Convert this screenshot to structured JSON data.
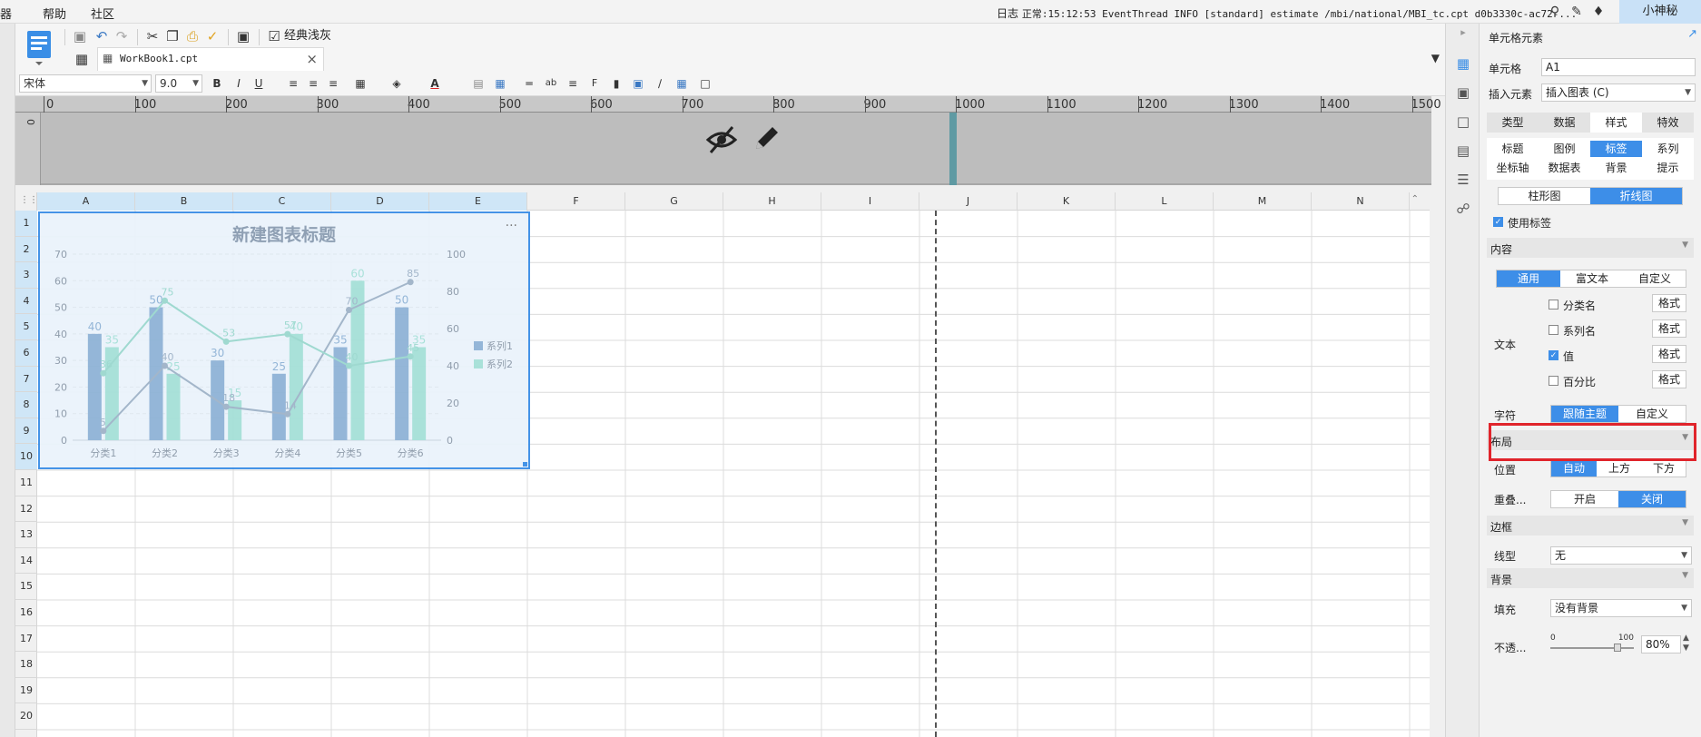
{
  "menubar": {
    "items": [
      "器",
      "帮助",
      "社区"
    ],
    "log_label": "日志",
    "log_text": "正常:15:12:53 EventThread INFO [standard] estimate /mbi/national/MBI_tc.cpt d0b3330c-ac72-...",
    "user": "小神秘"
  },
  "toolbar": {
    "classic_label": "经典浅灰"
  },
  "tabs": {
    "workbook_label": "WorkBook1.cpt",
    "close_glyph": "×"
  },
  "format": {
    "font_name": "宋体",
    "font_size": "9.0"
  },
  "ruler": {
    "ticks": [
      "0",
      "100",
      "200",
      "300",
      "400",
      "500",
      "600",
      "700",
      "800",
      "900",
      "1000",
      "1100",
      "1200",
      "1300",
      "1400",
      "1500"
    ],
    "left_tick": "0"
  },
  "sheet": {
    "columns": [
      "A",
      "B",
      "C",
      "D",
      "E",
      "F",
      "G",
      "H",
      "I",
      "J",
      "K",
      "L",
      "M",
      "N"
    ],
    "rows": [
      "1",
      "2",
      "3",
      "4",
      "5",
      "6",
      "7",
      "8",
      "9",
      "10",
      "11",
      "12",
      "13",
      "14",
      "15",
      "16",
      "17",
      "18",
      "19",
      "20"
    ]
  },
  "chart_data": {
    "type": "bar",
    "title": "新建图表标题",
    "categories": [
      "分类1",
      "分类2",
      "分类3",
      "分类4",
      "分类5",
      "分类6"
    ],
    "series": [
      {
        "name": "系列1",
        "type": "bar",
        "values": [
          40,
          50,
          30,
          25,
          35,
          50
        ],
        "color": "#8fb3d6"
      },
      {
        "name": "系列2",
        "type": "bar",
        "values": [
          35,
          25,
          15,
          40,
          60,
          35
        ],
        "color": "#a5e0d8"
      },
      {
        "name": "",
        "type": "line",
        "axis": "left",
        "values": [
          5,
          40,
          18,
          14,
          70,
          85
        ],
        "labels": [
          "5",
          "40",
          "18",
          "14",
          "70",
          "85"
        ],
        "color": "#9fb3c8"
      },
      {
        "name": "",
        "type": "line",
        "axis": "left",
        "values": [
          36,
          75,
          53,
          57,
          40,
          45
        ],
        "labels": [
          "36",
          "75",
          "53",
          "57",
          "40",
          "45"
        ],
        "color": "#9ad8ce"
      }
    ],
    "y_left_ticks": [
      "0",
      "10",
      "20",
      "30",
      "40",
      "50",
      "60",
      "70"
    ],
    "y_right_ticks": [
      "0",
      "20",
      "40",
      "60",
      "80",
      "100"
    ],
    "ylim_left": [
      0,
      70
    ],
    "ylim_right": [
      0,
      100
    ],
    "legend_position": "right",
    "grid": true,
    "more_glyph": "···"
  },
  "panel": {
    "header": "单元格元素",
    "cell_label": "单元格",
    "cell_value": "A1",
    "insert_label": "插入元素",
    "insert_value": "插入图表 (C)",
    "main_tabs": [
      "类型",
      "数据",
      "样式",
      "特效"
    ],
    "sub_tabs_row1": [
      "标题",
      "图例",
      "标签",
      "系列"
    ],
    "sub_tabs_row2": [
      "坐标轴",
      "数据表",
      "背景",
      "提示"
    ],
    "chart_type_tabs": [
      "柱形图",
      "折线图"
    ],
    "use_label": "使用标签",
    "content_section": "内容",
    "content_tabs": [
      "通用",
      "富文本",
      "自定义"
    ],
    "text_label": "文本",
    "text_options": [
      {
        "label": "分类名",
        "checked": false
      },
      {
        "label": "系列名",
        "checked": false
      },
      {
        "label": "值",
        "checked": true
      },
      {
        "label": "百分比",
        "checked": false
      }
    ],
    "format_btn": "格式",
    "char_label": "字符",
    "char_options": [
      "跟随主题",
      "自定义"
    ],
    "layout_section": "布局",
    "position_label": "位置",
    "position_options": [
      "自动",
      "上方",
      "下方"
    ],
    "overlap_label": "重叠...",
    "overlap_options": [
      "开启",
      "关闭"
    ],
    "border_section": "边框",
    "linetype_label": "线型",
    "linetype_value": "无",
    "bg_section": "背景",
    "fill_label": "填充",
    "fill_value": "没有背景",
    "opacity_label": "不透...",
    "opacity_min": "0",
    "opacity_max": "100",
    "opacity_value": "80%"
  }
}
